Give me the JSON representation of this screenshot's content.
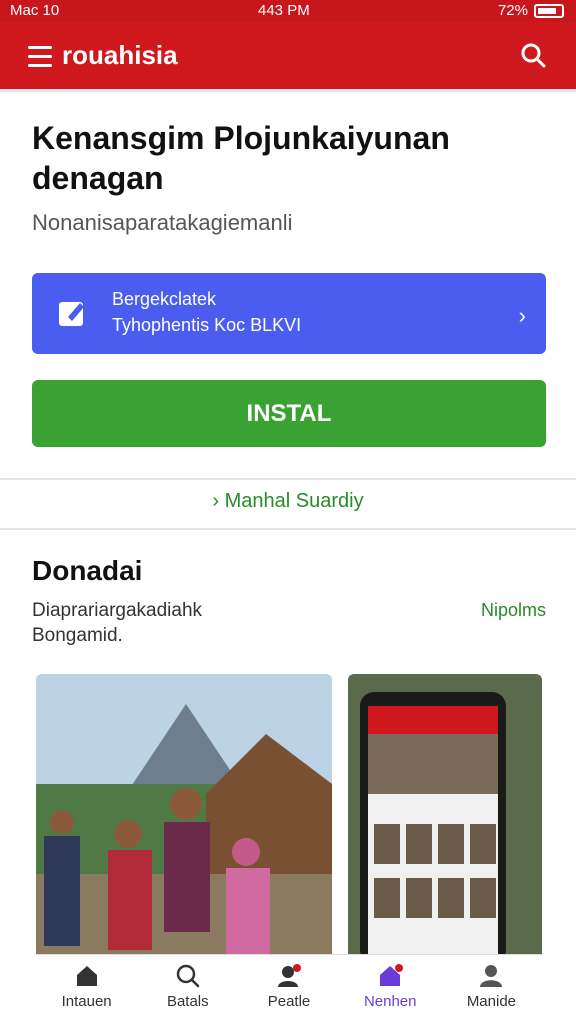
{
  "status": {
    "carrier": "Mac 10",
    "time": "443 PM",
    "battery": "72%"
  },
  "header": {
    "title": "rouahisia"
  },
  "hero": {
    "title": "Kenansgim Plojunkaiyunan denagan",
    "subtitle": "Nonanisaparatakagiemanli"
  },
  "promo": {
    "line1": "Bergekclatek",
    "line2": "Tyhophentis Koc BLKVI",
    "chevron": "›"
  },
  "install": {
    "label": "INSTAL"
  },
  "link": {
    "label": "Manhal Suardiy",
    "prefix": "›"
  },
  "section": {
    "title": "Donadai",
    "sub1": "Diaprariargakadiahk",
    "sub2": "Bongamid.",
    "link": "Nipolms"
  },
  "nav": [
    {
      "label": "Intauen",
      "icon": "home-icon"
    },
    {
      "label": "Batals",
      "icon": "search-icon"
    },
    {
      "label": "Peatle",
      "icon": "person-badge-icon"
    },
    {
      "label": "Nenhen",
      "icon": "home-badge-icon"
    },
    {
      "label": "Manide",
      "icon": "profile-icon"
    }
  ],
  "colors": {
    "brand_red": "#d0181f",
    "promo_blue": "#4a5df0",
    "install_green": "#3aa133",
    "link_green": "#2a8a2a",
    "nav_active": "#6a3bd6"
  }
}
